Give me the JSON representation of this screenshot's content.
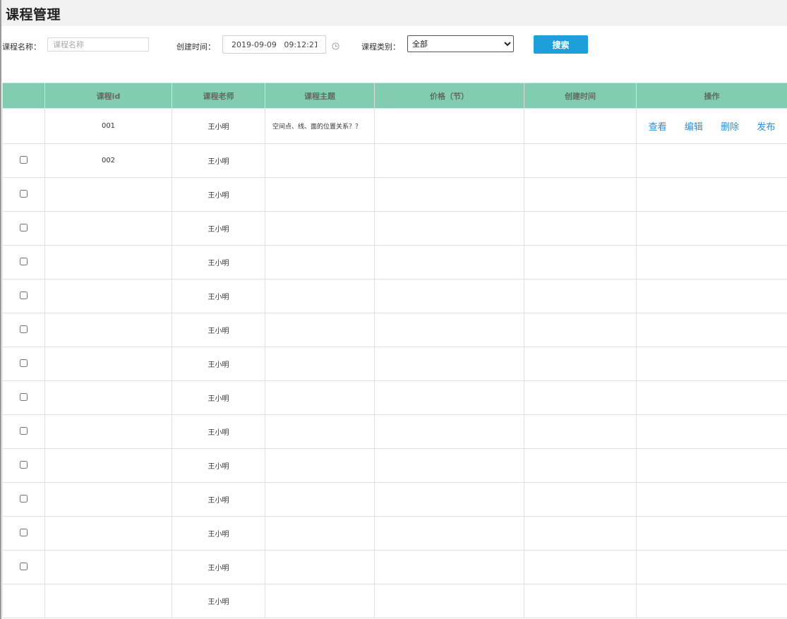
{
  "page": {
    "title": "课程管理"
  },
  "filter": {
    "name_label": "课程名称：",
    "name_placeholder": "课程名称",
    "time_label": "创建时间：",
    "time_value": "2019-09-09   09:12:21",
    "type_label": "课程类别：",
    "type_selected": "全部",
    "search_label": "搜索"
  },
  "table": {
    "headers": [
      "",
      "课程id",
      "课程老师",
      "课程主题",
      "价格（节）",
      "创建时间",
      "操作"
    ],
    "actions": [
      "查看",
      "编辑",
      "删除",
      "发布"
    ],
    "rows": [
      {
        "checkbox": false,
        "id": "001",
        "teacher": "王小明",
        "topic": "空间点、线、面的位置关系？？",
        "price": "",
        "created": "",
        "has_actions": true
      },
      {
        "checkbox": true,
        "id": "002",
        "teacher": "王小明",
        "topic": "",
        "price": "",
        "created": "",
        "has_actions": false
      },
      {
        "checkbox": true,
        "id": "",
        "teacher": "王小明",
        "topic": "",
        "price": "",
        "created": "",
        "has_actions": false
      },
      {
        "checkbox": true,
        "id": "",
        "teacher": "王小明",
        "topic": "",
        "price": "",
        "created": "",
        "has_actions": false
      },
      {
        "checkbox": true,
        "id": "",
        "teacher": "王小明",
        "topic": "",
        "price": "",
        "created": "",
        "has_actions": false
      },
      {
        "checkbox": true,
        "id": "",
        "teacher": "王小明",
        "topic": "",
        "price": "",
        "created": "",
        "has_actions": false
      },
      {
        "checkbox": true,
        "id": "",
        "teacher": "王小明",
        "topic": "",
        "price": "",
        "created": "",
        "has_actions": false
      },
      {
        "checkbox": true,
        "id": "",
        "teacher": "王小明",
        "topic": "",
        "price": "",
        "created": "",
        "has_actions": false
      },
      {
        "checkbox": true,
        "id": "",
        "teacher": "王小明",
        "topic": "",
        "price": "",
        "created": "",
        "has_actions": false
      },
      {
        "checkbox": true,
        "id": "",
        "teacher": "王小明",
        "topic": "",
        "price": "",
        "created": "",
        "has_actions": false
      },
      {
        "checkbox": true,
        "id": "",
        "teacher": "王小明",
        "topic": "",
        "price": "",
        "created": "",
        "has_actions": false
      },
      {
        "checkbox": true,
        "id": "",
        "teacher": "王小明",
        "topic": "",
        "price": "",
        "created": "",
        "has_actions": false
      },
      {
        "checkbox": true,
        "id": "",
        "teacher": "王小明",
        "topic": "",
        "price": "",
        "created": "",
        "has_actions": false
      },
      {
        "checkbox": true,
        "id": "",
        "teacher": "王小明",
        "topic": "",
        "price": "",
        "created": "",
        "has_actions": false
      },
      {
        "checkbox": false,
        "id": "",
        "teacher": "王小明",
        "topic": "",
        "price": "",
        "created": "",
        "has_actions": false
      }
    ]
  },
  "colors": {
    "header_bg": "#f2f2f2",
    "table_header_bg": "#82cdb2",
    "search_button": "#1e9fd9",
    "action_link": "#2d8fd5"
  }
}
